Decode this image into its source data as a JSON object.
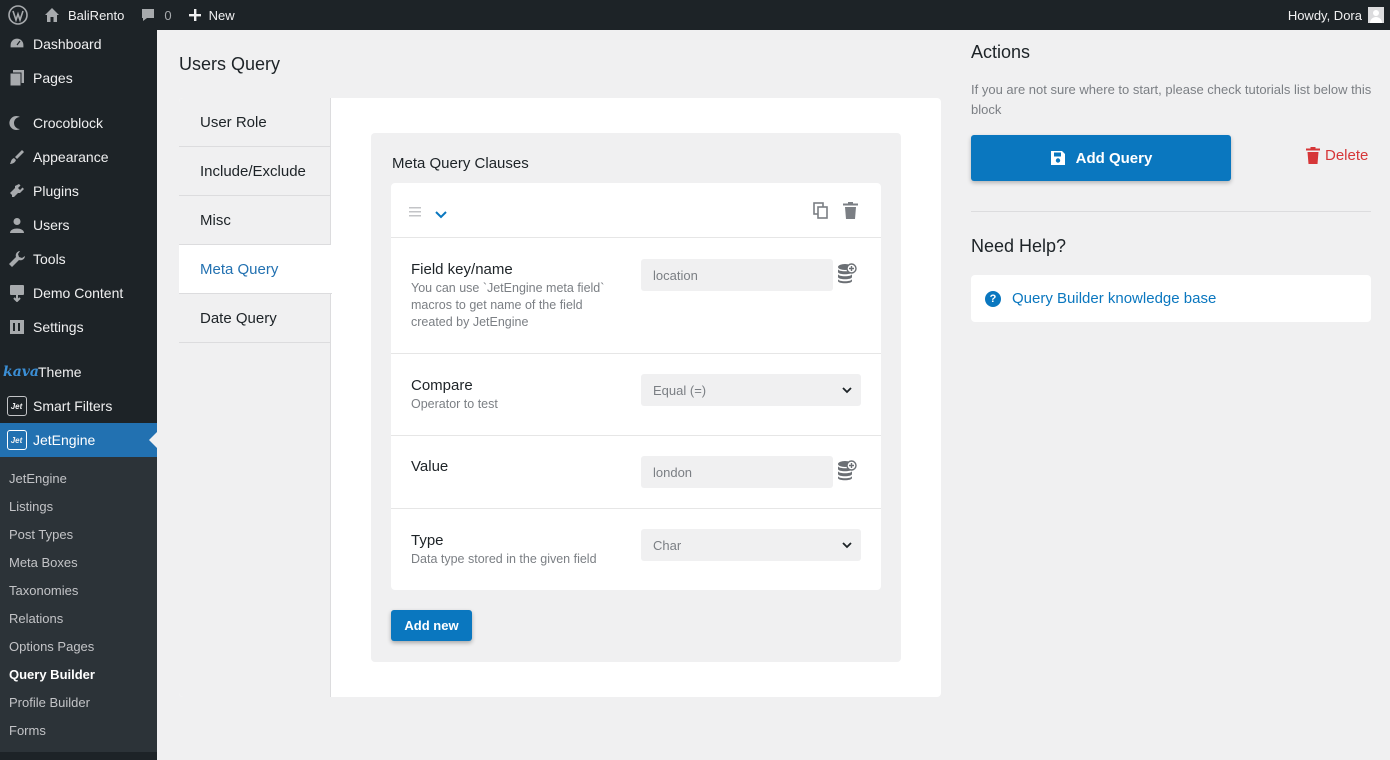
{
  "adminbar": {
    "site_name": "BaliRento",
    "comments_count": "0",
    "new_label": "New",
    "howdy": "Howdy, Dora"
  },
  "sidebar": {
    "items": [
      {
        "label": "Dashboard",
        "icon": "dashboard-icon"
      },
      {
        "label": "Pages",
        "icon": "pages-icon"
      },
      {
        "label": "Crocoblock",
        "icon": "crocoblock-icon"
      },
      {
        "label": "Appearance",
        "icon": "appearance-icon"
      },
      {
        "label": "Plugins",
        "icon": "plugins-icon"
      },
      {
        "label": "Users",
        "icon": "users-icon"
      },
      {
        "label": "Tools",
        "icon": "tools-icon"
      },
      {
        "label": "Demo Content",
        "icon": "demo-content-icon"
      },
      {
        "label": "Settings",
        "icon": "settings-icon"
      },
      {
        "label": "Theme",
        "icon": "kava-logo",
        "logo_text": "kava"
      },
      {
        "label": "Smart Filters",
        "icon": "jet-icon",
        "badge": "Jet"
      },
      {
        "label": "JetEngine",
        "icon": "jet-icon",
        "badge": "Jet"
      }
    ],
    "submenu": [
      "JetEngine",
      "Listings",
      "Post Types",
      "Meta Boxes",
      "Taxonomies",
      "Relations",
      "Options Pages",
      "Query Builder",
      "Profile Builder",
      "Forms"
    ]
  },
  "main": {
    "title": "Users Query",
    "tabs": [
      "User Role",
      "Include/Exclude",
      "Misc",
      "Meta Query",
      "Date Query"
    ],
    "active_tab": "Meta Query",
    "clauses_title": "Meta Query Clauses",
    "fields": {
      "field_key": {
        "label": "Field key/name",
        "desc": [
          "You can use `JetEngine meta field`",
          "macros to get name of the field",
          "created by JetEngine"
        ],
        "placeholder": "location"
      },
      "compare": {
        "label": "Compare",
        "desc": "Operator to test",
        "value": "Equal (=)"
      },
      "value": {
        "label": "Value",
        "placeholder": "london"
      },
      "type": {
        "label": "Type",
        "desc": "Data type stored in the given field",
        "value": "Char"
      }
    },
    "add_new_label": "Add new"
  },
  "actions": {
    "title": "Actions",
    "note": "If you are not sure where to start, please check tutorials list below this block",
    "add_query_label": "Add Query",
    "delete_label": "Delete"
  },
  "help": {
    "title": "Need Help?",
    "link_label": "Query Builder knowledge base"
  },
  "colors": {
    "accent": "#0a77bf",
    "admin_dark": "#1d2327",
    "menu_active": "#2271b1",
    "delete_red": "#d63638"
  }
}
